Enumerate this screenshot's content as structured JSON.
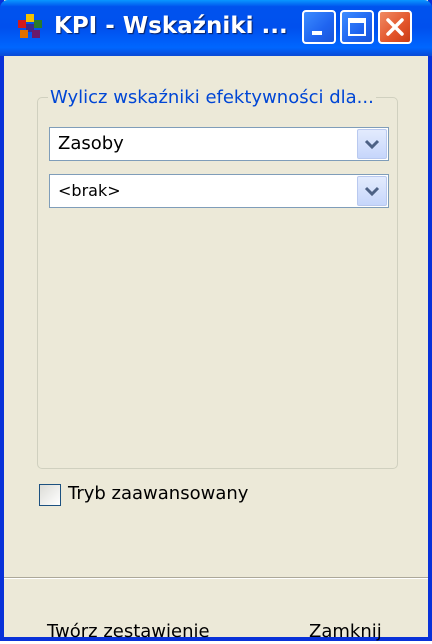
{
  "window": {
    "title": "KPI - Wskaźniki ...",
    "app_icon": "kpi-app-icon",
    "title_bar_color": "#0054e3",
    "controls": {
      "minimize_icon": "minimize-icon",
      "maximize_icon": "maximize-icon",
      "close_icon": "close-icon"
    }
  },
  "group": {
    "legend": "Wylicz wskaźniki efektywności dla...",
    "legend_color": "#0046d5"
  },
  "combos": [
    {
      "value": "Zasoby",
      "arrow_icon": "chevron-down-icon"
    },
    {
      "value": "<brak>",
      "arrow_icon": "chevron-down-icon"
    }
  ],
  "advanced_mode": {
    "label": "Tryb zaawansowany",
    "checked": false
  },
  "footer": {
    "create_label": "Twórz zestawienie",
    "close_label": "Zamknij"
  }
}
